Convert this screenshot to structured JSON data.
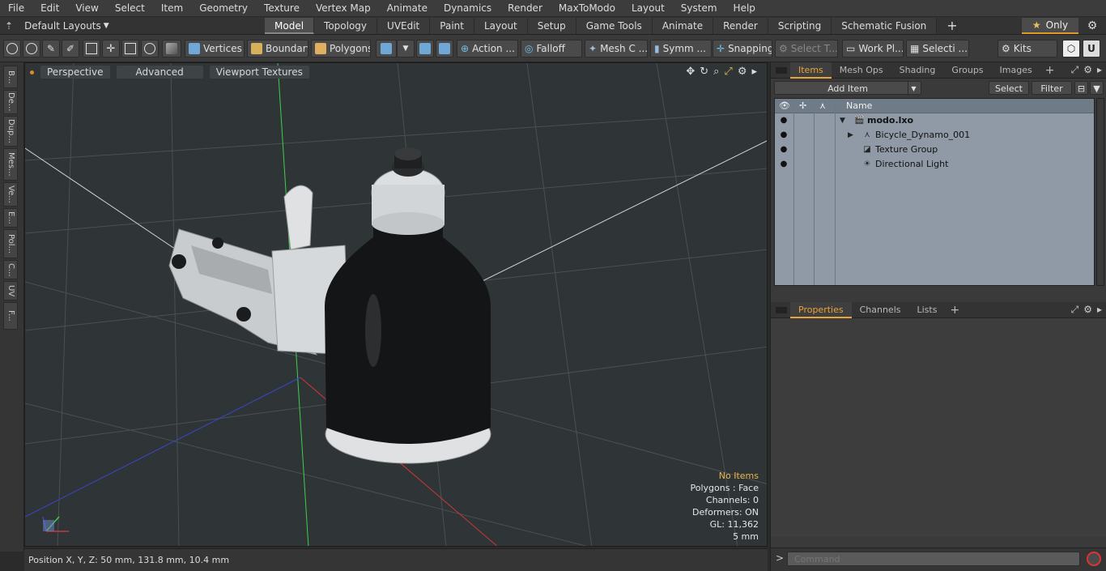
{
  "menu": [
    "File",
    "Edit",
    "View",
    "Select",
    "Item",
    "Geometry",
    "Texture",
    "Vertex Map",
    "Animate",
    "Dynamics",
    "Render",
    "MaxToModo",
    "Layout",
    "System",
    "Help"
  ],
  "layout_select": "Default Layouts",
  "mode_tabs": [
    "Model",
    "Topology",
    "UVEdit",
    "Paint",
    "Layout",
    "Setup",
    "Game Tools",
    "Animate",
    "Render",
    "Scripting",
    "Schematic Fusion"
  ],
  "active_mode_tab": "Model",
  "only_label": "Only",
  "toolbar": {
    "vertices": "Vertices",
    "boundary": "Boundary",
    "polygons": "Polygons",
    "action": "Action ...",
    "falloff": "Falloff",
    "mesh": "Mesh C ...",
    "symm": "Symm ...",
    "snapping": "Snapping",
    "select_t": "Select T...",
    "work_plane": "Work Pl...",
    "selecti": "Selecti ...",
    "kits": "Kits"
  },
  "left_tabs": [
    "B...",
    "De...",
    "Dup...",
    "Mes...",
    "Ve...",
    "E...",
    "Pol...",
    "C...",
    "UV",
    "F..."
  ],
  "viewport": {
    "buttons": [
      "Perspective",
      "Advanced",
      "Viewport Textures"
    ],
    "info_warning": "No Items",
    "info_lines": [
      "Polygons : Face",
      "Channels: 0",
      "Deformers: ON",
      "GL: 11,362",
      "5 mm"
    ]
  },
  "status": "Position X, Y, Z:   50 mm, 131.8 mm, 10.4 mm",
  "items_panel": {
    "tabs": [
      "Items",
      "Mesh Ops",
      "Shading",
      "Groups",
      "Images"
    ],
    "active_tab": "Items",
    "add_item": "Add Item",
    "select": "Select",
    "filter": "Filter",
    "name_col": "Name",
    "rows": [
      {
        "label": "modo.lxo"
      },
      {
        "label": "Bicycle_Dynamo_001"
      },
      {
        "label": "Texture Group"
      },
      {
        "label": "Directional Light"
      }
    ]
  },
  "props_panel": {
    "tabs": [
      "Properties",
      "Channels",
      "Lists"
    ],
    "active_tab": "Properties"
  },
  "command_placeholder": "Command",
  "colors": {
    "accent": "#e8a33b",
    "viewport_bg": "#2f3436",
    "list_bg": "#8f9aa6"
  }
}
